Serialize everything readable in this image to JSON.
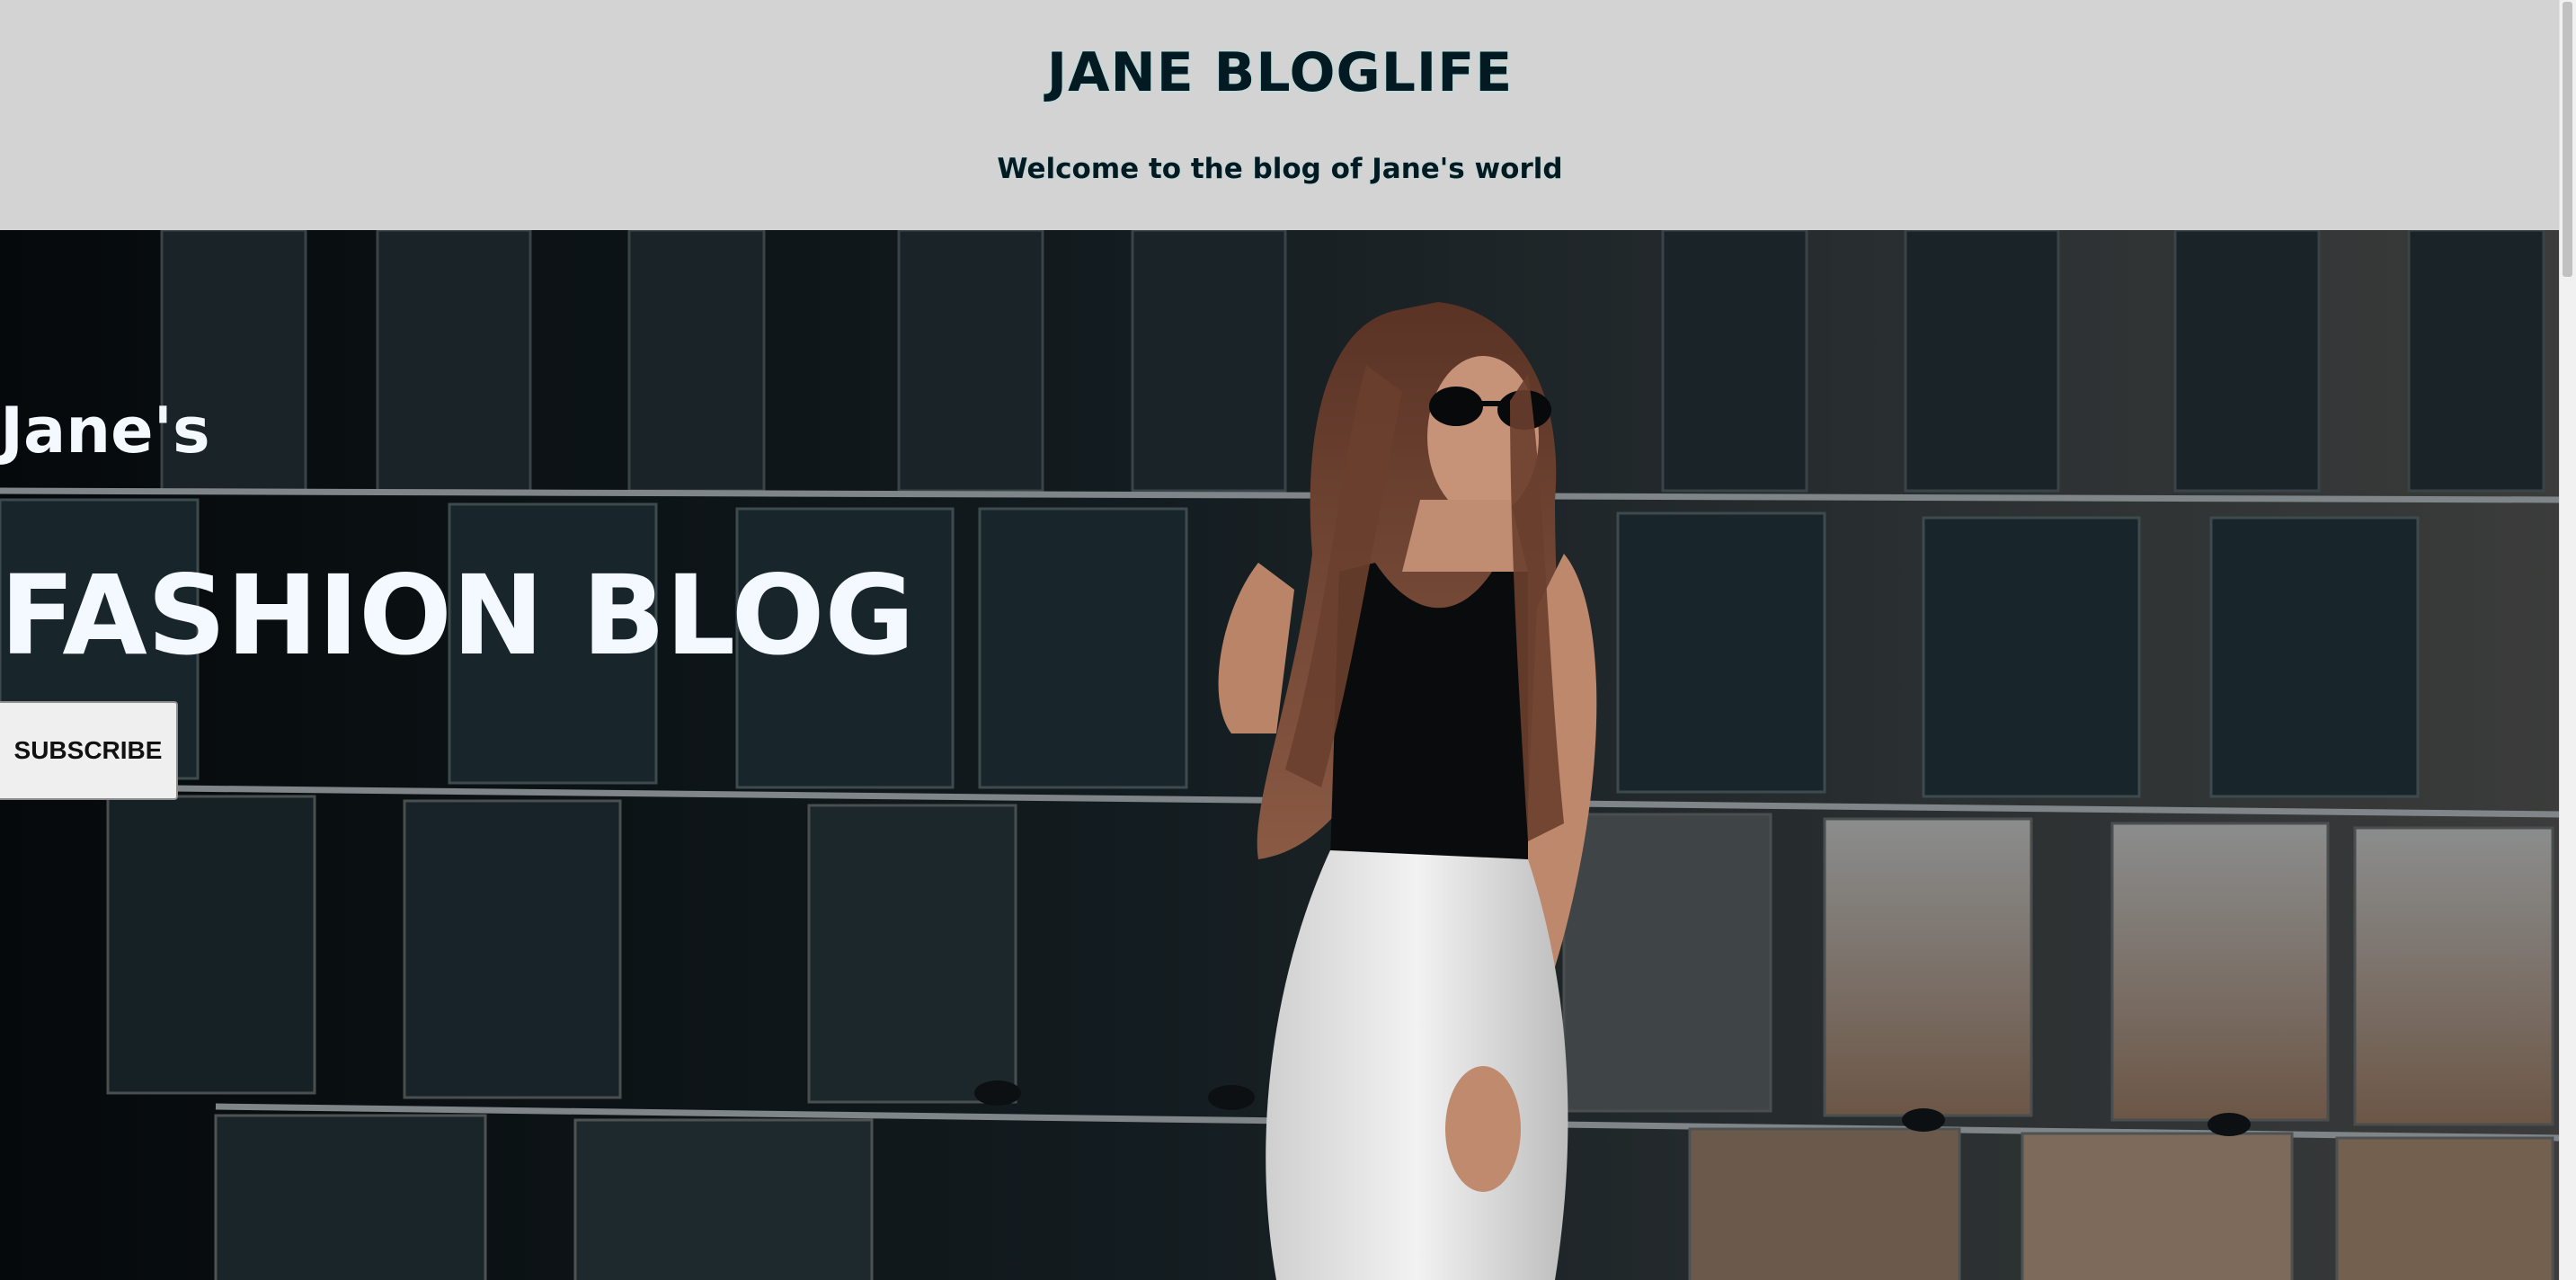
{
  "header": {
    "title": "JANE BLOGLIFE",
    "subtitle": "Welcome to the blog of Jane's world"
  },
  "hero": {
    "kicker": "Jane's",
    "title": "FASHION BLOG",
    "subscribe_label": "SUBSCRIBE",
    "image_alt": ""
  },
  "colors": {
    "header_bg": "#d3d3d3",
    "header_text": "#041a22",
    "hero_text": "#f4f8ff",
    "button_bg": "#efefef"
  }
}
